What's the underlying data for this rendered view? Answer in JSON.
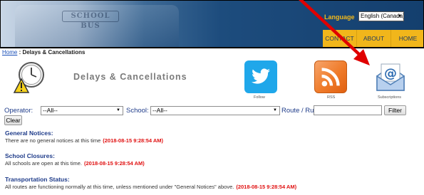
{
  "header": {
    "bus_sign": "SCHOOL BUS",
    "language_label": "Language",
    "language_value": "English (Canada)",
    "nav": [
      "CONTACT",
      "ABOUT",
      "HOME"
    ]
  },
  "breadcrumb": {
    "home": "Home",
    "separator": " : ",
    "current": "Delays & Cancellations"
  },
  "page_title": "Delays & Cancellations",
  "links": {
    "follow": "Follow",
    "rss": "RSS",
    "subscriptions": "Subscriptions"
  },
  "filters": {
    "operator_label": "Operator:",
    "operator_value": "--All--",
    "school_label": "School:",
    "school_value": "--All--",
    "route_label": "Route / Run:",
    "route_value": "",
    "filter_button": "Filter",
    "clear_button": "Clear"
  },
  "sections": [
    {
      "title": "General Notices:",
      "text": "There are no general notices at this time",
      "stamp": "(2018-08-15 9:28:54 AM)"
    },
    {
      "title": "School Closures:",
      "text": "All schools are open at this time.",
      "stamp": "(2018-08-15 9:28:54 AM)"
    },
    {
      "title": "Transportation Status:",
      "text": "All routes are functioning normally at this time, unless mentioned under \"General Notices\" above.",
      "stamp": "(2018-08-15 9:28:54 AM)"
    }
  ],
  "icons": {
    "delay": "clock-warning-icon",
    "twitter": "twitter-bird-icon",
    "rss": "rss-feed-icon",
    "subscriptions": "email-at-icon",
    "annotation": "red-arrow-icon"
  },
  "colors": {
    "nav_background": "#f1b61b",
    "language_label": "#f2b81a",
    "label_blue": "#1f3c8a",
    "timestamp_red": "#e01010",
    "twitter_blue": "#1fa7ea",
    "rss_orange": "#ef7b2a",
    "annotation_arrow": "#e00000"
  }
}
